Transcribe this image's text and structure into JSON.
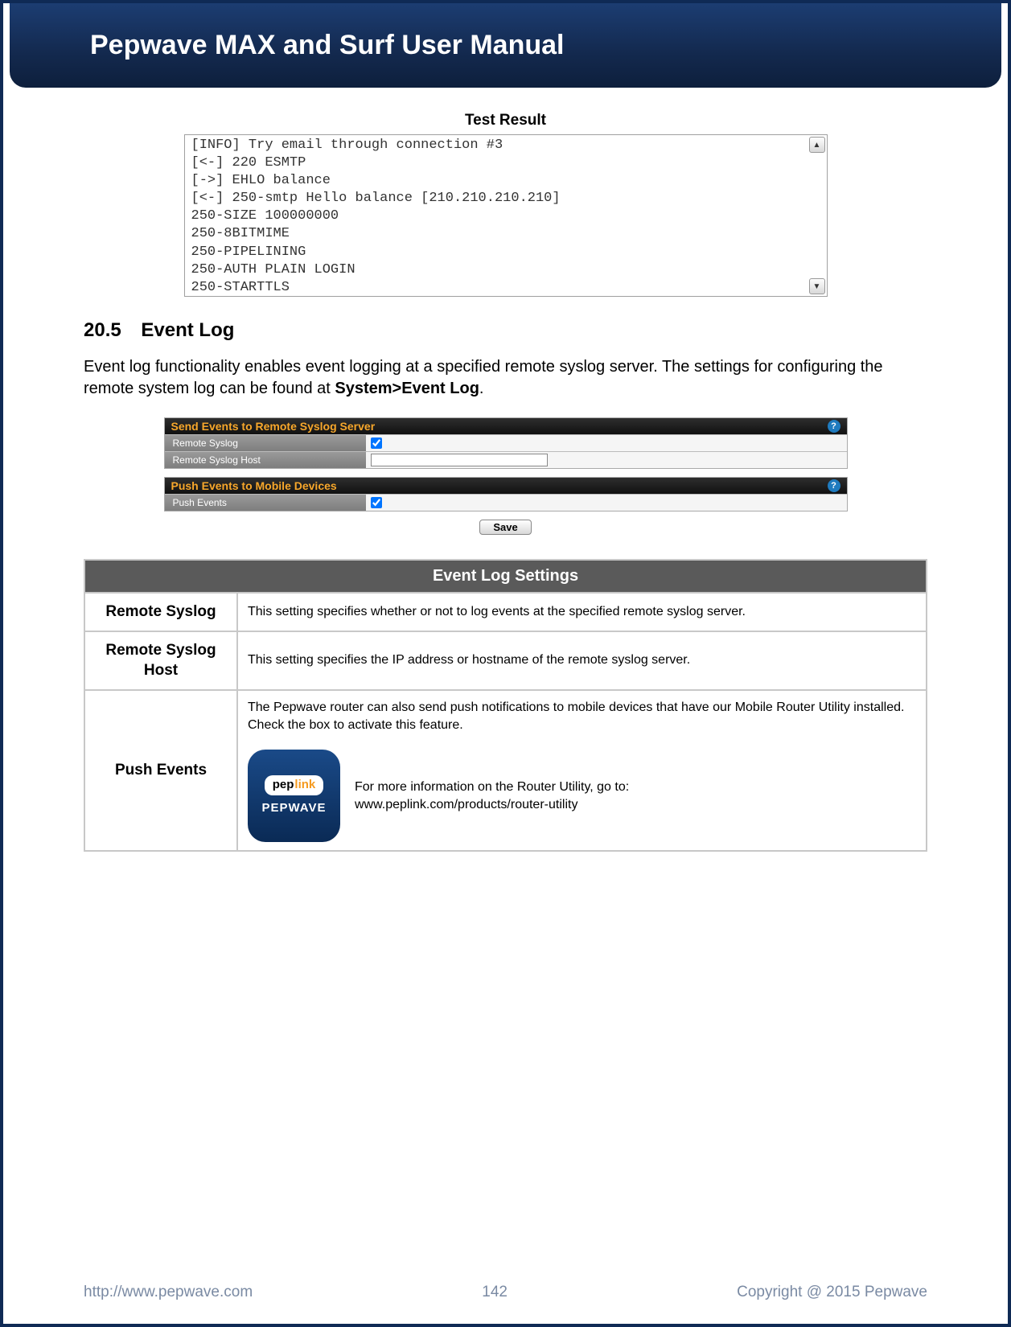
{
  "header": {
    "title": "Pepwave MAX and Surf User Manual"
  },
  "test_result": {
    "title": "Test Result",
    "lines": "[INFO] Try email through connection #3\n[<-] 220 ESMTP\n[->] EHLO balance\n[<-] 250-smtp Hello balance [210.210.210.210]\n250-SIZE 100000000\n250-8BITMIME\n250-PIPELINING\n250-AUTH PLAIN LOGIN\n250-STARTTLS"
  },
  "section": {
    "number": "20.5",
    "title": "Event Log",
    "para_prefix": "Event log functionality enables event logging at a specified remote syslog server. The settings for configuring the remote system log can be found at ",
    "breadcrumb": "System>Event Log",
    "para_suffix": "."
  },
  "cfg": {
    "panel1_title": "Send Events to Remote Syslog Server",
    "panel1_row1_label": "Remote Syslog",
    "panel1_row2_label": "Remote Syslog Host",
    "panel2_title": "Push Events to Mobile Devices",
    "panel2_row1_label": "Push Events",
    "save": "Save"
  },
  "table": {
    "title": "Event Log Settings",
    "rows": [
      {
        "key": "Remote Syslog",
        "val": "This setting specifies whether or not to log events at the specified remote syslog server."
      },
      {
        "key": "Remote Syslog Host",
        "val": "This setting specifies the IP address or hostname of the remote syslog server."
      }
    ],
    "push": {
      "key": "Push Events",
      "p1": "The Pepwave router can also send push notifications to mobile devices that have our Mobile Router Utility installed. Check the box to activate this feature.",
      "p2a": "For more information on the Router Utility, go to:",
      "p2b": "www.peplink.com/products/router-utility",
      "tile_brand1a": "pep",
      "tile_brand1b": "link",
      "tile_brand2": "PEPWAVE"
    }
  },
  "footer": {
    "url": "http://www.pepwave.com",
    "page": "142",
    "copyright": "Copyright @ 2015 Pepwave"
  }
}
